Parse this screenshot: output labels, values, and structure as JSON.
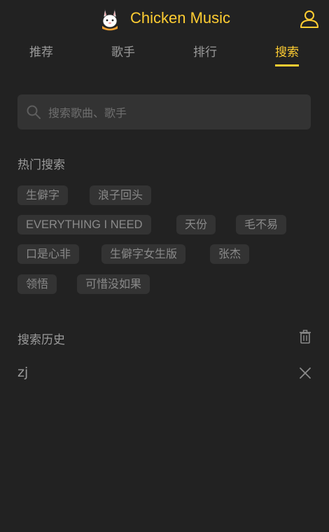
{
  "app": {
    "title": "Chicken Music",
    "accent_color": "#ffcd32",
    "background_color": "#222222"
  },
  "header": {
    "logo": "rabbit-logo",
    "user_icon": "user-icon"
  },
  "tabs": [
    {
      "label": "推荐",
      "active": false
    },
    {
      "label": "歌手",
      "active": false
    },
    {
      "label": "排行",
      "active": false
    },
    {
      "label": "搜索",
      "active": true
    }
  ],
  "search": {
    "placeholder": "搜索歌曲、歌手",
    "value": "",
    "icon": "search-icon"
  },
  "hot_search": {
    "title": "热门搜索",
    "tags": [
      "生僻字",
      "浪子回头",
      "EVERYTHING I NEED",
      "天份",
      "毛不易",
      "口是心非",
      "生僻字女生版",
      "张杰",
      "领悟",
      "可惜没如果"
    ]
  },
  "history": {
    "title": "搜索历史",
    "clear_icon": "trash-icon",
    "items": [
      {
        "text": "zj",
        "delete_icon": "close-icon"
      }
    ]
  }
}
